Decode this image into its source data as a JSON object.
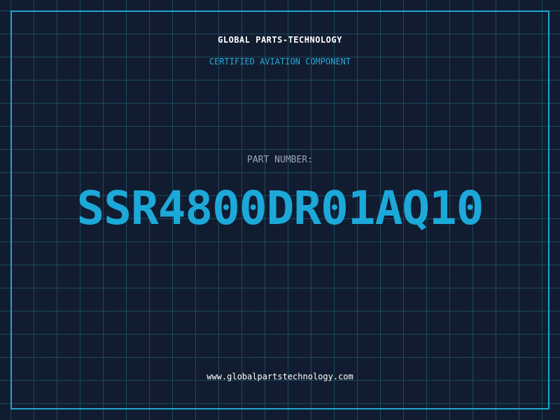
{
  "header": {
    "company": "GLOBAL PARTS-TECHNOLOGY",
    "subtitle": "CERTIFIED AVIATION COMPONENT"
  },
  "part": {
    "label": "PART NUMBER:",
    "number": "SSR4800DR01AQ10"
  },
  "footer": {
    "website": "www.globalpartstechnology.com"
  },
  "colors": {
    "background": "#121c30",
    "grid": "#226e84",
    "frame": "#1ea6cc",
    "accent": "#1ca9d9",
    "label": "#9aa4b2",
    "text": "#ffffff"
  }
}
